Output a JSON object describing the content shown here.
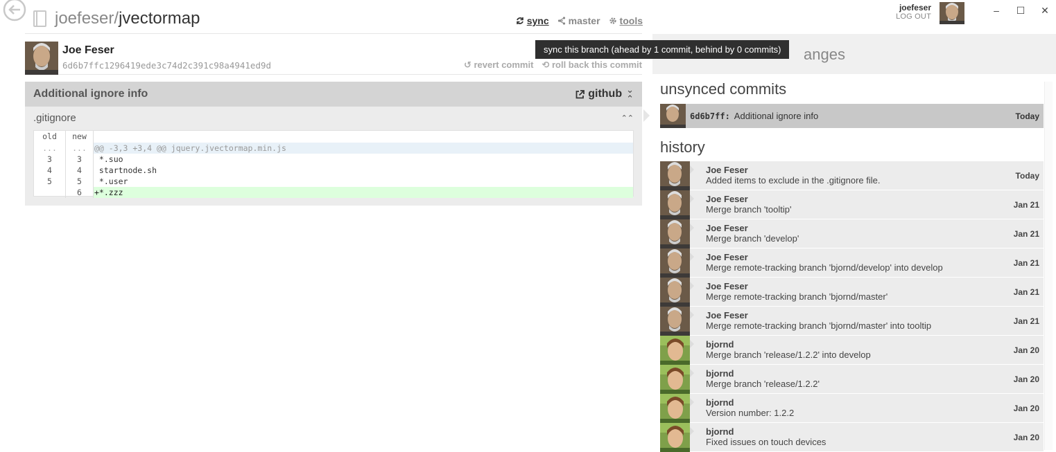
{
  "repo": {
    "owner": "joefeser",
    "separator": "/",
    "name": "jvectormap"
  },
  "toolbar": {
    "sync_label": "sync",
    "branch_label": "master",
    "tools_label": "tools"
  },
  "user": {
    "login": "joefeser",
    "logout_label": "LOG OUT"
  },
  "window": {
    "minimize": "–",
    "maximize": "☐",
    "close": "✕"
  },
  "commit": {
    "author": "Joe Feser",
    "sha": "6d6b7ffc1296419ede3c74d2c391c98a4941ed9d",
    "revert_label": "revert commit",
    "rollback_label": "roll back this commit"
  },
  "tooltip": {
    "text": "sync this branch (ahead by 1 commit, behind by 0 commits)"
  },
  "diff": {
    "title": "Additional ignore info",
    "github_label": "github",
    "file_name": ".gitignore",
    "header": {
      "old": "old",
      "new": "new"
    },
    "rows": [
      {
        "old": "...",
        "new": "...",
        "code": "@@ -3,3 +3,4 @@ jquery.jvectormap.min.js"
      },
      {
        "old": "3",
        "new": "3",
        "code": " *.suo"
      },
      {
        "old": "4",
        "new": "4",
        "code": " startnode.sh"
      },
      {
        "old": "5",
        "new": "5",
        "code": " *.user"
      },
      {
        "old": "",
        "new": "6",
        "code": "+*.zzz"
      }
    ]
  },
  "changes": {
    "title_visible": "anges"
  },
  "unsynced": {
    "title": "unsynced commits",
    "sha": "6d6b7ff:",
    "message": "Additional ignore info",
    "date": "Today"
  },
  "history": {
    "title": "history",
    "items": [
      {
        "author": "Joe Feser",
        "message": "Added items to exclude in the .gitignore file.",
        "date": "Today"
      },
      {
        "author": "Joe Feser",
        "message": "Merge branch 'tooltip'",
        "date": "Jan 21"
      },
      {
        "author": "Joe Feser",
        "message": "Merge branch 'develop'",
        "date": "Jan 21"
      },
      {
        "author": "Joe Feser",
        "message": "Merge remote-tracking branch 'bjornd/develop' into develop",
        "date": "Jan 21"
      },
      {
        "author": "Joe Feser",
        "message": "Merge remote-tracking branch 'bjornd/master'",
        "date": "Jan 21"
      },
      {
        "author": "Joe Feser",
        "message": "Merge remote-tracking branch 'bjornd/master' into tooltip",
        "date": "Jan 21"
      },
      {
        "author": "bjornd",
        "message": "Merge branch 'release/1.2.2' into develop",
        "date": "Jan 20"
      },
      {
        "author": "bjornd",
        "message": "Merge branch 'release/1.2.2'",
        "date": "Jan 20"
      },
      {
        "author": "bjornd",
        "message": "Version number: 1.2.2",
        "date": "Jan 20"
      },
      {
        "author": "bjornd",
        "message": "Fixed issues on touch devices",
        "date": "Jan 20"
      }
    ]
  }
}
